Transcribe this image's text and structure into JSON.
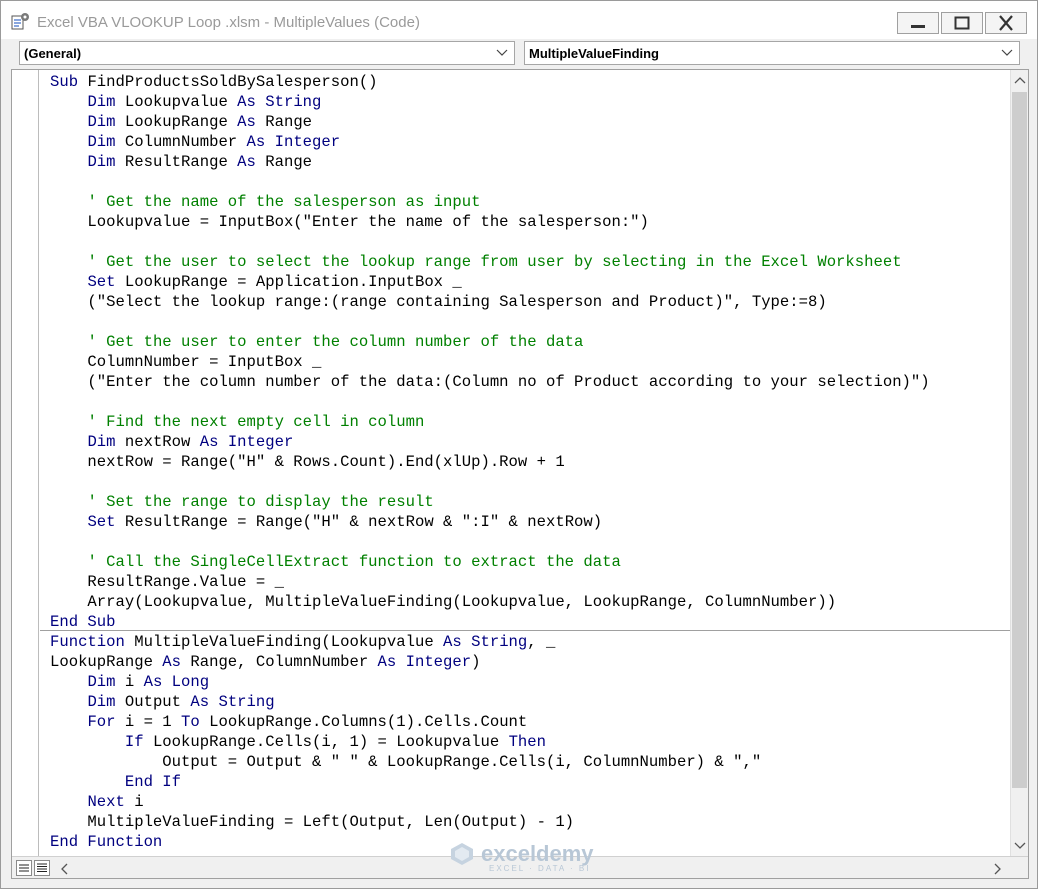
{
  "window": {
    "title": "Excel VBA VLOOKUP Loop .xlsm - MultipleValues (Code)",
    "icon": "vba-code-icon"
  },
  "controls": {
    "minimize": "minimize-icon",
    "maximize": "maximize-icon",
    "close": "close-icon"
  },
  "object_combo": {
    "value": "(General)"
  },
  "procedure_combo": {
    "value": "MultipleValueFinding"
  },
  "colors": {
    "keyword": "#00007f",
    "comment": "#008000",
    "text": "#000000"
  },
  "code": {
    "lines": [
      [
        [
          "k",
          "Sub "
        ],
        [
          "t",
          "FindProductsSoldBySalesperson()"
        ]
      ],
      [
        [
          "t",
          "    "
        ],
        [
          "k",
          "Dim "
        ],
        [
          "t",
          "Lookupvalue "
        ],
        [
          "k",
          "As String"
        ]
      ],
      [
        [
          "t",
          "    "
        ],
        [
          "k",
          "Dim "
        ],
        [
          "t",
          "LookupRange "
        ],
        [
          "k",
          "As "
        ],
        [
          "t",
          "Range"
        ]
      ],
      [
        [
          "t",
          "    "
        ],
        [
          "k",
          "Dim "
        ],
        [
          "t",
          "ColumnNumber "
        ],
        [
          "k",
          "As Integer"
        ]
      ],
      [
        [
          "t",
          "    "
        ],
        [
          "k",
          "Dim "
        ],
        [
          "t",
          "ResultRange "
        ],
        [
          "k",
          "As "
        ],
        [
          "t",
          "Range"
        ]
      ],
      [
        [
          "t",
          ""
        ]
      ],
      [
        [
          "t",
          "    "
        ],
        [
          "c",
          "' Get the name of the salesperson as input"
        ]
      ],
      [
        [
          "t",
          "    Lookupvalue = InputBox(\"Enter the name of the salesperson:\")"
        ]
      ],
      [
        [
          "t",
          ""
        ]
      ],
      [
        [
          "t",
          "    "
        ],
        [
          "c",
          "' Get the user to select the lookup range from user by selecting in the Excel Worksheet"
        ]
      ],
      [
        [
          "t",
          "    "
        ],
        [
          "k",
          "Set "
        ],
        [
          "t",
          "LookupRange = Application.InputBox _"
        ]
      ],
      [
        [
          "t",
          "    (\"Select the lookup range:(range containing Salesperson and Product)\", Type:=8)"
        ]
      ],
      [
        [
          "t",
          ""
        ]
      ],
      [
        [
          "t",
          "    "
        ],
        [
          "c",
          "' Get the user to enter the column number of the data"
        ]
      ],
      [
        [
          "t",
          "    ColumnNumber = InputBox _"
        ]
      ],
      [
        [
          "t",
          "    (\"Enter the column number of the data:(Column no of Product according to your selection)\")"
        ]
      ],
      [
        [
          "t",
          ""
        ]
      ],
      [
        [
          "t",
          "    "
        ],
        [
          "c",
          "' Find the next empty cell in column"
        ]
      ],
      [
        [
          "t",
          "    "
        ],
        [
          "k",
          "Dim "
        ],
        [
          "t",
          "nextRow "
        ],
        [
          "k",
          "As Integer"
        ]
      ],
      [
        [
          "t",
          "    nextRow = Range(\"H\" & Rows.Count).End(xlUp).Row + 1"
        ]
      ],
      [
        [
          "t",
          ""
        ]
      ],
      [
        [
          "t",
          "    "
        ],
        [
          "c",
          "' Set the range to display the result"
        ]
      ],
      [
        [
          "t",
          "    "
        ],
        [
          "k",
          "Set "
        ],
        [
          "t",
          "ResultRange = Range(\"H\" & nextRow & \":I\" & nextRow)"
        ]
      ],
      [
        [
          "t",
          ""
        ]
      ],
      [
        [
          "t",
          "    "
        ],
        [
          "c",
          "' Call the SingleCellExtract function to extract the data"
        ]
      ],
      [
        [
          "t",
          "    ResultRange.Value = _"
        ]
      ],
      [
        [
          "t",
          "    Array(Lookupvalue, MultipleValueFinding(Lookupvalue, LookupRange, ColumnNumber))"
        ]
      ],
      [
        [
          "k",
          "End Sub"
        ]
      ],
      [
        [
          "k",
          "Function "
        ],
        [
          "t",
          "MultipleValueFinding(Lookupvalue "
        ],
        [
          "k",
          "As String"
        ],
        [
          "t",
          ", _"
        ]
      ],
      [
        [
          "t",
          "LookupRange "
        ],
        [
          "k",
          "As "
        ],
        [
          "t",
          "Range, ColumnNumber "
        ],
        [
          "k",
          "As Integer"
        ],
        [
          "t",
          ")"
        ]
      ],
      [
        [
          "t",
          "    "
        ],
        [
          "k",
          "Dim "
        ],
        [
          "t",
          "i "
        ],
        [
          "k",
          "As Long"
        ]
      ],
      [
        [
          "t",
          "    "
        ],
        [
          "k",
          "Dim "
        ],
        [
          "t",
          "Output "
        ],
        [
          "k",
          "As String"
        ]
      ],
      [
        [
          "t",
          "    "
        ],
        [
          "k",
          "For "
        ],
        [
          "t",
          "i = 1 "
        ],
        [
          "k",
          "To "
        ],
        [
          "t",
          "LookupRange.Columns(1).Cells.Count"
        ]
      ],
      [
        [
          "t",
          "        "
        ],
        [
          "k",
          "If "
        ],
        [
          "t",
          "LookupRange.Cells(i, 1) = Lookupvalue "
        ],
        [
          "k",
          "Then"
        ]
      ],
      [
        [
          "t",
          "            Output = Output & \" \" & LookupRange.Cells(i, ColumnNumber) & \",\""
        ]
      ],
      [
        [
          "t",
          "        "
        ],
        [
          "k",
          "End If"
        ]
      ],
      [
        [
          "t",
          "    "
        ],
        [
          "k",
          "Next "
        ],
        [
          "t",
          "i"
        ]
      ],
      [
        [
          "t",
          "    MultipleValueFinding = Left(Output, Len(Output) - 1)"
        ]
      ],
      [
        [
          "k",
          "End Function"
        ]
      ]
    ]
  },
  "watermark": {
    "name": "exceldemy",
    "tagline": "EXCEL · DATA · BI"
  }
}
